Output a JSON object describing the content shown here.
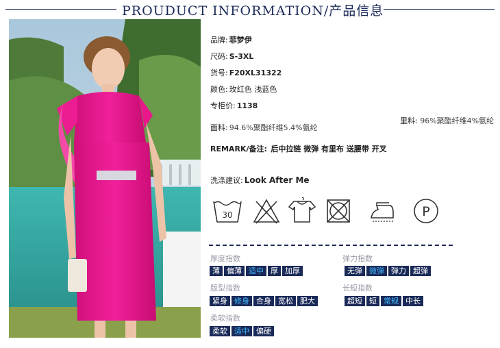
{
  "header": {
    "title": "PROUDUCT INFORMATION/产品信息"
  },
  "product": {
    "brand": {
      "label": "品牌:",
      "value": "菲梦伊"
    },
    "size": {
      "label": "尺码:",
      "value": "S-3XL"
    },
    "item_no": {
      "label": "货号:",
      "value": "F20XL31322"
    },
    "color": {
      "label": "颜色:",
      "value": "玫红色 浅蓝色"
    },
    "price": {
      "label": "专柜价:",
      "value": "1138"
    },
    "fabric": {
      "label": "面料:",
      "value": "94.6%聚酯纤维5.4%氨纶"
    },
    "lining": {
      "label": "里料:",
      "value": "96%聚酯纤维4%氨纶"
    },
    "remark": {
      "label": "REMARK/备注:",
      "value": "后中拉链 微弹 有里布 送腰带 开叉"
    },
    "wash": {
      "label": "洗涤建议:",
      "value": "Look After Me"
    }
  },
  "care_icons": [
    {
      "name": "wash-30-icon",
      "text": "30"
    },
    {
      "name": "no-bleach-icon"
    },
    {
      "name": "hang-dry-icon"
    },
    {
      "name": "no-tumble-dry-icon"
    },
    {
      "name": "iron-low-icon"
    },
    {
      "name": "dry-clean-p-icon",
      "text": "P"
    }
  ],
  "indices": {
    "thickness": {
      "title": "厚度指数",
      "options": [
        "薄",
        "偏薄",
        "适中",
        "厚",
        "加厚"
      ],
      "selected": 2
    },
    "elasticity": {
      "title": "弹力指数",
      "options": [
        "无弹",
        "微弹",
        "弹力",
        "超弹"
      ],
      "selected": 1
    },
    "fit": {
      "title": "版型指数",
      "options": [
        "紧身",
        "修身",
        "合身",
        "宽松",
        "肥大"
      ],
      "selected": 1
    },
    "length": {
      "title": "长短指数",
      "options": [
        "超短",
        "短",
        "常规",
        "中长"
      ],
      "selected": 2
    },
    "softness": {
      "title": "柔软指数",
      "options": [
        "柔软",
        "适中",
        "偏硬"
      ],
      "selected": 1
    }
  },
  "colors": {
    "navy": "#1a2a58",
    "highlight": "#3fb7ff",
    "dress": "#e8178a"
  }
}
